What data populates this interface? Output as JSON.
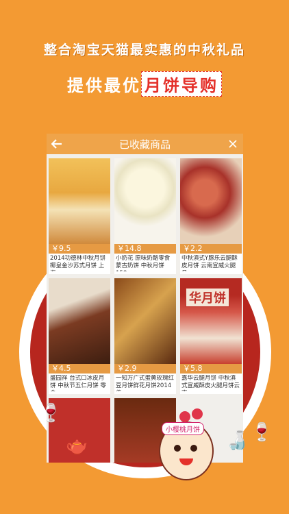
{
  "headline": {
    "line1": "整合淘宝天猫最实惠的中秋礼品",
    "line2_prefix": "提供最优",
    "line2_highlight": "月饼导购"
  },
  "topbar": {
    "title": "已收藏商品",
    "back_icon": "back-arrow-icon",
    "close_icon": "close-icon"
  },
  "products": [
    {
      "price": "￥9.5",
      "desc": "2014功德林中秋月饼 椰皇金沙苏式月饼 上海..."
    },
    {
      "price": "￥14.8",
      "desc": "小奶花 原味奶酪零食 蒙古奶饼 中秋月饼158g"
    },
    {
      "price": "￥2.2",
      "desc": "中秋滇式Y豚乐云腿酥皮月饼 云南宣威火腿月..."
    },
    {
      "price": "￥4.5",
      "desc": "盛园祥 台式口冰皮月饼 中秋节五仁月饼 零食..."
    },
    {
      "price": "￥2.9",
      "desc": "一知万广式蛋黄玫瑰红豆月饼鲜花月饼2014传..."
    },
    {
      "price": "￥5.8",
      "desc": "嘉华云腿月饼 中秋滇式宣威酥皮火腿月饼云南..."
    }
  ],
  "stamp_text": "华月饼",
  "mascot_label": "小樱桃月饼",
  "colors": {
    "background": "#f39a33",
    "topbar": "#efa44a",
    "accent_red": "#e4302a"
  }
}
